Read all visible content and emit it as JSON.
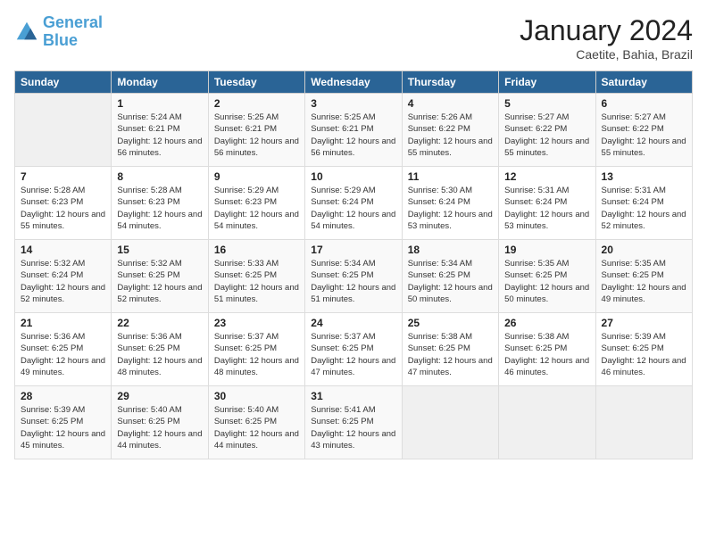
{
  "header": {
    "logo_line1": "General",
    "logo_line2": "Blue",
    "month": "January 2024",
    "location": "Caetite, Bahia, Brazil"
  },
  "days_of_week": [
    "Sunday",
    "Monday",
    "Tuesday",
    "Wednesday",
    "Thursday",
    "Friday",
    "Saturday"
  ],
  "weeks": [
    [
      {
        "day": "",
        "sunrise": "",
        "sunset": "",
        "daylight": ""
      },
      {
        "day": "1",
        "sunrise": "Sunrise: 5:24 AM",
        "sunset": "Sunset: 6:21 PM",
        "daylight": "Daylight: 12 hours and 56 minutes."
      },
      {
        "day": "2",
        "sunrise": "Sunrise: 5:25 AM",
        "sunset": "Sunset: 6:21 PM",
        "daylight": "Daylight: 12 hours and 56 minutes."
      },
      {
        "day": "3",
        "sunrise": "Sunrise: 5:25 AM",
        "sunset": "Sunset: 6:21 PM",
        "daylight": "Daylight: 12 hours and 56 minutes."
      },
      {
        "day": "4",
        "sunrise": "Sunrise: 5:26 AM",
        "sunset": "Sunset: 6:22 PM",
        "daylight": "Daylight: 12 hours and 55 minutes."
      },
      {
        "day": "5",
        "sunrise": "Sunrise: 5:27 AM",
        "sunset": "Sunset: 6:22 PM",
        "daylight": "Daylight: 12 hours and 55 minutes."
      },
      {
        "day": "6",
        "sunrise": "Sunrise: 5:27 AM",
        "sunset": "Sunset: 6:22 PM",
        "daylight": "Daylight: 12 hours and 55 minutes."
      }
    ],
    [
      {
        "day": "7",
        "sunrise": "Sunrise: 5:28 AM",
        "sunset": "Sunset: 6:23 PM",
        "daylight": "Daylight: 12 hours and 55 minutes."
      },
      {
        "day": "8",
        "sunrise": "Sunrise: 5:28 AM",
        "sunset": "Sunset: 6:23 PM",
        "daylight": "Daylight: 12 hours and 54 minutes."
      },
      {
        "day": "9",
        "sunrise": "Sunrise: 5:29 AM",
        "sunset": "Sunset: 6:23 PM",
        "daylight": "Daylight: 12 hours and 54 minutes."
      },
      {
        "day": "10",
        "sunrise": "Sunrise: 5:29 AM",
        "sunset": "Sunset: 6:24 PM",
        "daylight": "Daylight: 12 hours and 54 minutes."
      },
      {
        "day": "11",
        "sunrise": "Sunrise: 5:30 AM",
        "sunset": "Sunset: 6:24 PM",
        "daylight": "Daylight: 12 hours and 53 minutes."
      },
      {
        "day": "12",
        "sunrise": "Sunrise: 5:31 AM",
        "sunset": "Sunset: 6:24 PM",
        "daylight": "Daylight: 12 hours and 53 minutes."
      },
      {
        "day": "13",
        "sunrise": "Sunrise: 5:31 AM",
        "sunset": "Sunset: 6:24 PM",
        "daylight": "Daylight: 12 hours and 52 minutes."
      }
    ],
    [
      {
        "day": "14",
        "sunrise": "Sunrise: 5:32 AM",
        "sunset": "Sunset: 6:24 PM",
        "daylight": "Daylight: 12 hours and 52 minutes."
      },
      {
        "day": "15",
        "sunrise": "Sunrise: 5:32 AM",
        "sunset": "Sunset: 6:25 PM",
        "daylight": "Daylight: 12 hours and 52 minutes."
      },
      {
        "day": "16",
        "sunrise": "Sunrise: 5:33 AM",
        "sunset": "Sunset: 6:25 PM",
        "daylight": "Daylight: 12 hours and 51 minutes."
      },
      {
        "day": "17",
        "sunrise": "Sunrise: 5:34 AM",
        "sunset": "Sunset: 6:25 PM",
        "daylight": "Daylight: 12 hours and 51 minutes."
      },
      {
        "day": "18",
        "sunrise": "Sunrise: 5:34 AM",
        "sunset": "Sunset: 6:25 PM",
        "daylight": "Daylight: 12 hours and 50 minutes."
      },
      {
        "day": "19",
        "sunrise": "Sunrise: 5:35 AM",
        "sunset": "Sunset: 6:25 PM",
        "daylight": "Daylight: 12 hours and 50 minutes."
      },
      {
        "day": "20",
        "sunrise": "Sunrise: 5:35 AM",
        "sunset": "Sunset: 6:25 PM",
        "daylight": "Daylight: 12 hours and 49 minutes."
      }
    ],
    [
      {
        "day": "21",
        "sunrise": "Sunrise: 5:36 AM",
        "sunset": "Sunset: 6:25 PM",
        "daylight": "Daylight: 12 hours and 49 minutes."
      },
      {
        "day": "22",
        "sunrise": "Sunrise: 5:36 AM",
        "sunset": "Sunset: 6:25 PM",
        "daylight": "Daylight: 12 hours and 48 minutes."
      },
      {
        "day": "23",
        "sunrise": "Sunrise: 5:37 AM",
        "sunset": "Sunset: 6:25 PM",
        "daylight": "Daylight: 12 hours and 48 minutes."
      },
      {
        "day": "24",
        "sunrise": "Sunrise: 5:37 AM",
        "sunset": "Sunset: 6:25 PM",
        "daylight": "Daylight: 12 hours and 47 minutes."
      },
      {
        "day": "25",
        "sunrise": "Sunrise: 5:38 AM",
        "sunset": "Sunset: 6:25 PM",
        "daylight": "Daylight: 12 hours and 47 minutes."
      },
      {
        "day": "26",
        "sunrise": "Sunrise: 5:38 AM",
        "sunset": "Sunset: 6:25 PM",
        "daylight": "Daylight: 12 hours and 46 minutes."
      },
      {
        "day": "27",
        "sunrise": "Sunrise: 5:39 AM",
        "sunset": "Sunset: 6:25 PM",
        "daylight": "Daylight: 12 hours and 46 minutes."
      }
    ],
    [
      {
        "day": "28",
        "sunrise": "Sunrise: 5:39 AM",
        "sunset": "Sunset: 6:25 PM",
        "daylight": "Daylight: 12 hours and 45 minutes."
      },
      {
        "day": "29",
        "sunrise": "Sunrise: 5:40 AM",
        "sunset": "Sunset: 6:25 PM",
        "daylight": "Daylight: 12 hours and 44 minutes."
      },
      {
        "day": "30",
        "sunrise": "Sunrise: 5:40 AM",
        "sunset": "Sunset: 6:25 PM",
        "daylight": "Daylight: 12 hours and 44 minutes."
      },
      {
        "day": "31",
        "sunrise": "Sunrise: 5:41 AM",
        "sunset": "Sunset: 6:25 PM",
        "daylight": "Daylight: 12 hours and 43 minutes."
      },
      {
        "day": "",
        "sunrise": "",
        "sunset": "",
        "daylight": ""
      },
      {
        "day": "",
        "sunrise": "",
        "sunset": "",
        "daylight": ""
      },
      {
        "day": "",
        "sunrise": "",
        "sunset": "",
        "daylight": ""
      }
    ]
  ]
}
